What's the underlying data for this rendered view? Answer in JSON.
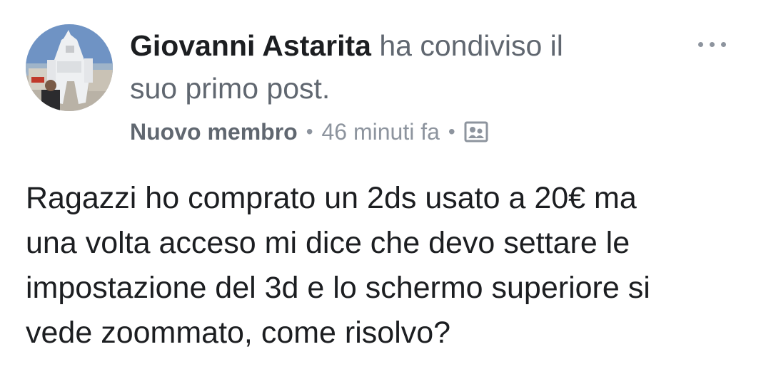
{
  "post": {
    "author": "Giovanni Astarita",
    "action_line1": "ha condiviso il",
    "action_line2": "suo primo post.",
    "badge": "Nuovo membro",
    "separator": "•",
    "timestamp": "46 minuti fa",
    "privacy_icon": "photo-group-icon",
    "more_icon": "more-options-icon",
    "text_lines": [
      "Ragazzi ho comprato un 2ds usato a 20€ ma",
      "una volta acceso mi dice che devo settare le",
      "impostazione del 3d e lo schermo superiore si",
      "vede zoommato, come risolvo?"
    ]
  },
  "colors": {
    "author": "#1c1e21",
    "secondary": "#606770",
    "meta": "#8d949e",
    "background": "#ffffff"
  }
}
